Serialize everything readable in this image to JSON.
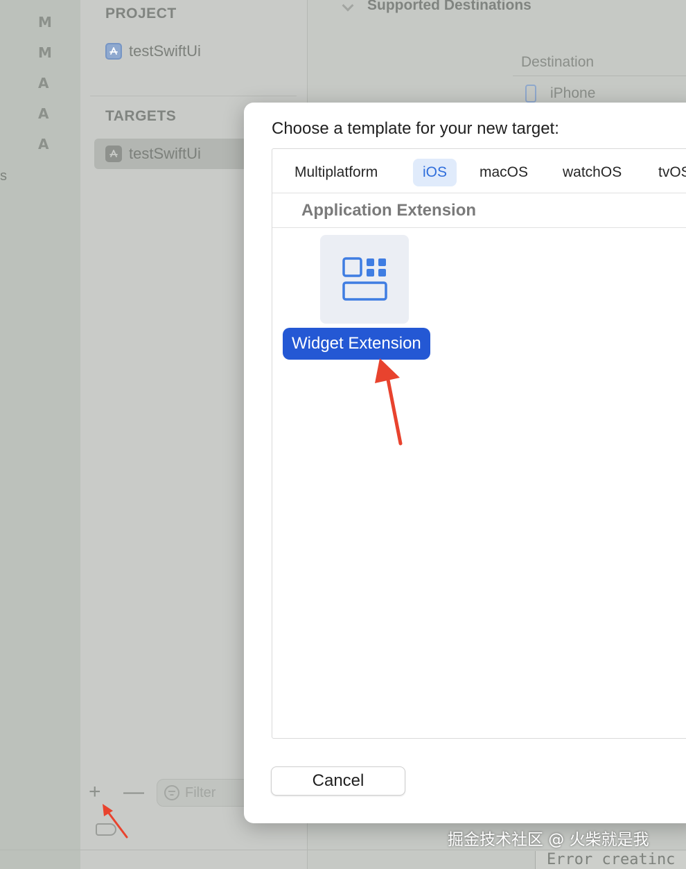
{
  "left_strip": {
    "letters": [
      "M",
      "M",
      "A",
      "A",
      "A"
    ],
    "fragment": "s"
  },
  "nav": {
    "project_header": "PROJECT",
    "project_item": "testSwiftUi",
    "targets_header": "TARGETS",
    "target_item": "testSwiftUi",
    "filter_placeholder": "Filter",
    "add_symbol": "+",
    "remove_symbol": "—"
  },
  "editor": {
    "supported_destinations_header": "Supported Destinations",
    "destination_column": "Destination",
    "destination_row": "iPhone",
    "error_text": "Error creatinc"
  },
  "sheet": {
    "title": "Choose a template for your new target:",
    "tabs": [
      "Multiplatform",
      "iOS",
      "macOS",
      "watchOS",
      "tvOS"
    ],
    "selected_tab": "iOS",
    "category_header": "Application Extension",
    "template_label": "Widget Extension",
    "cancel_label": "Cancel"
  },
  "watermark": "掘金技术社区 @ 火柴就是我",
  "colors": {
    "accent": "#2458d4",
    "selected_tab_bg": "#e0ebfb",
    "annotation_arrow": "#e8432e",
    "widget_icon": "#3f7de2"
  }
}
